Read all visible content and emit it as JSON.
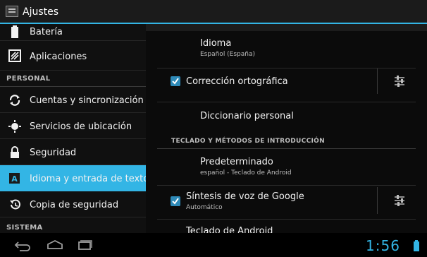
{
  "app": {
    "title": "Ajustes",
    "icon": "settings-app-icon"
  },
  "sidebar": {
    "items": [
      {
        "label": "Batería",
        "icon": "battery-icon"
      },
      {
        "label": "Aplicaciones",
        "icon": "apps-icon"
      },
      {
        "label": "Cuentas y sincronización",
        "icon": "sync-icon"
      },
      {
        "label": "Servicios de ubicación",
        "icon": "location-icon"
      },
      {
        "label": "Seguridad",
        "icon": "lock-icon"
      },
      {
        "label": "Idioma y entrada de texto",
        "icon": "keyboard-a-icon",
        "selected": true
      },
      {
        "label": "Copia de seguridad",
        "icon": "backup-icon"
      }
    ],
    "sections": {
      "personal": "PERSONAL",
      "sistema": "SISTEMA"
    }
  },
  "main": {
    "language": {
      "title": "Idioma",
      "value": "Español (España)"
    },
    "spellcheck": {
      "title": "Corrección ortográfica",
      "checked": true
    },
    "dictionary": {
      "title": "Diccionario personal"
    },
    "keyboard_section": "TECLADO Y MÉTODOS DE INTRODUCCIÓN",
    "default": {
      "title": "Predeterminado",
      "value": "español - Teclado de Android"
    },
    "tts": {
      "title": "Síntesis de voz de Google",
      "value": "Automático",
      "checked": true
    },
    "android_keyboard": {
      "title": "Teclado de Android"
    }
  },
  "statusbar": {
    "time": "1:56"
  },
  "colors": {
    "accent": "#33b5e5",
    "selected_bg": "#33b5e5"
  }
}
